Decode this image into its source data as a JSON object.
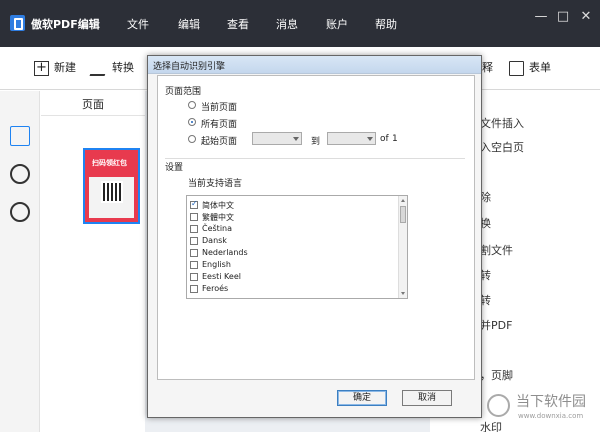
{
  "window": {
    "title": "傲软PDF编辑",
    "menu": [
      "文件",
      "编辑",
      "查看",
      "消息",
      "账户",
      "帮助"
    ],
    "controls": [
      "—",
      "□",
      "✕"
    ]
  },
  "toolbar": {
    "new_label": "新建",
    "convert_label": "转换",
    "release_label": "释",
    "form_label": "表单"
  },
  "left_panel": {
    "title": "页面",
    "thumbnail_text": "扫码领红包"
  },
  "right_panel": {
    "items": [
      "文件插入",
      "入空白页",
      "除",
      "换",
      "割文件",
      "转",
      "转",
      "并PDF",
      "，页脚",
      "水印"
    ]
  },
  "dialog": {
    "title": "选择自动识别引擎",
    "page_range": {
      "label": "页面范围",
      "current": "当前页面",
      "all": "所有页面",
      "start": "起始页面",
      "to": "到",
      "of": "of",
      "total": "1"
    },
    "settings": {
      "label": "设置",
      "current_languages": "当前支持语言",
      "languages": [
        "简体中文",
        "繁體中文",
        "Čeština",
        "Dansk",
        "Nederlands",
        "English",
        "Eesti Keel",
        "Feroés"
      ]
    },
    "buttons": {
      "ok": "确定",
      "cancel": "取消"
    }
  },
  "watermark": {
    "name": "当下软件园",
    "url": "www.downxia.com"
  },
  "colors": {
    "titlebar": "#2c2f37",
    "accent": "#1f83f2",
    "thumbnail_red": "#e83a4e"
  }
}
